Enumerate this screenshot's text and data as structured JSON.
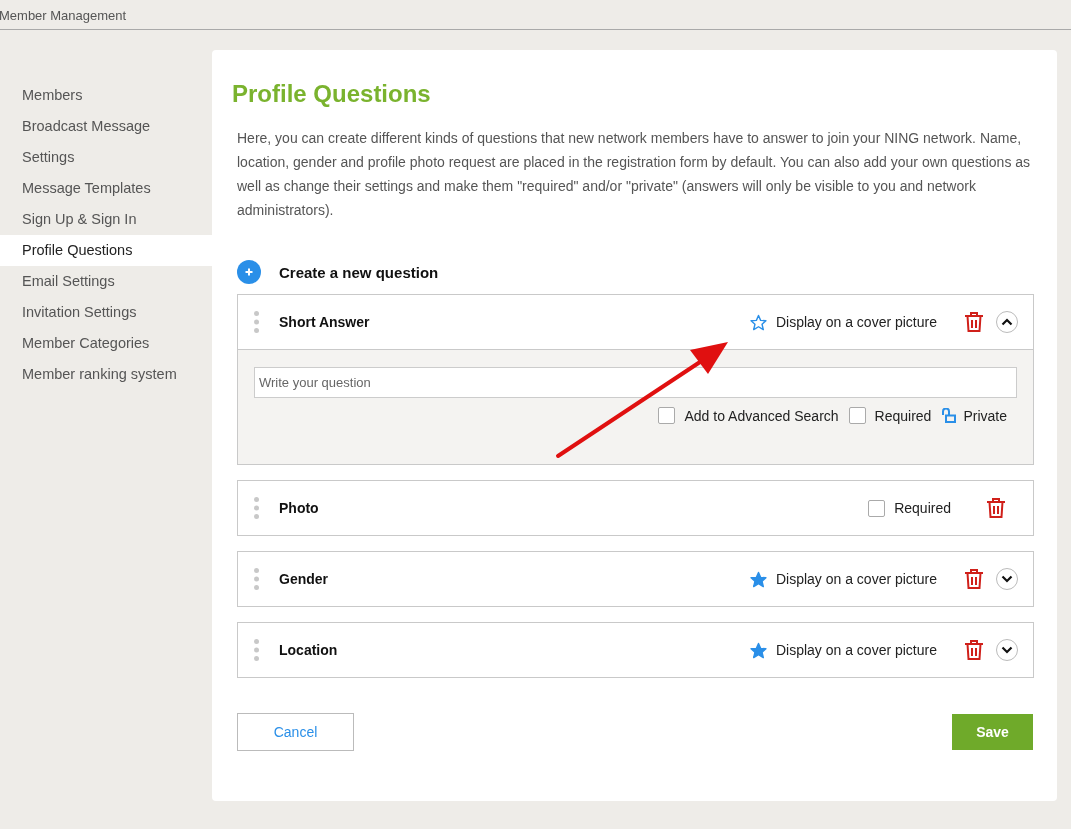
{
  "header": {
    "title": "Member Management"
  },
  "sidebar": {
    "items": [
      {
        "label": "Members",
        "selected": false
      },
      {
        "label": "Broadcast Message",
        "selected": false
      },
      {
        "label": "Settings",
        "selected": false
      },
      {
        "label": "Message Templates",
        "selected": false
      },
      {
        "label": "Sign Up & Sign In",
        "selected": false
      },
      {
        "label": "Profile Questions",
        "selected": true
      },
      {
        "label": "Email Settings",
        "selected": false
      },
      {
        "label": "Invitation Settings",
        "selected": false
      },
      {
        "label": "Member Categories",
        "selected": false
      },
      {
        "label": "Member ranking system",
        "selected": false
      }
    ]
  },
  "page": {
    "title": "Profile Questions",
    "description": "Here, you can create different kinds of questions that new network members have to answer to join your NING network. Name, location, gender and profile photo request are placed in the registration form by default. You can also add your own questions as well as change their settings and make them \"required\" and/or \"private\" (answers will only be visible to you and network administrators)."
  },
  "create": {
    "label": "Create a new question"
  },
  "questions": [
    {
      "name": "Short Answer",
      "cover": {
        "label": "Display on a cover picture",
        "starred": false
      },
      "expanded": true,
      "body": {
        "placeholder": "Write your question",
        "options": [
          {
            "kind": "checkbox",
            "label": "Add to Advanced Search",
            "checked": false
          },
          {
            "kind": "checkbox",
            "label": "Required",
            "checked": false
          },
          {
            "kind": "lock",
            "label": "Private",
            "locked": false
          }
        ]
      }
    },
    {
      "name": "Photo",
      "required": {
        "label": "Required",
        "checked": false
      }
    },
    {
      "name": "Gender",
      "cover": {
        "label": "Display on a cover picture",
        "starred": true
      },
      "expanded": false
    },
    {
      "name": "Location",
      "cover": {
        "label": "Display on a cover picture",
        "starred": true
      },
      "expanded": false
    }
  ],
  "buttons": {
    "cancel": "Cancel",
    "save": "Save"
  }
}
